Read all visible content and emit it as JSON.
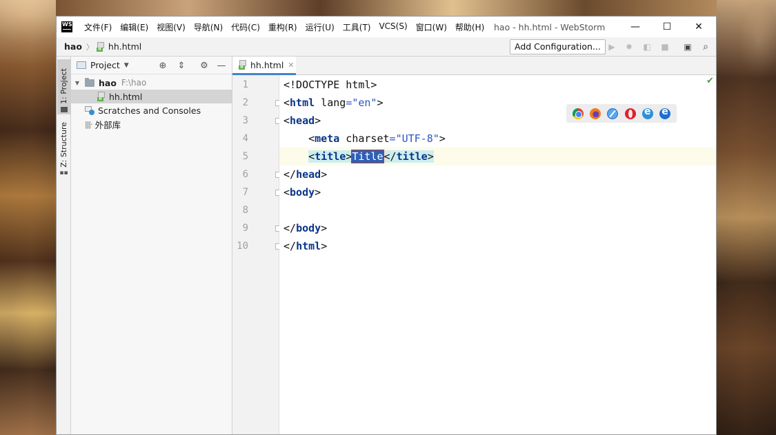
{
  "window": {
    "app_logo": "WS",
    "title": "hao - hh.html - WebStorm",
    "menu": [
      "文件(F)",
      "编辑(E)",
      "视图(V)",
      "导航(N)",
      "代码(C)",
      "重构(R)",
      "运行(U)",
      "工具(T)",
      "VCS(S)",
      "窗口(W)",
      "帮助(H)"
    ],
    "controls": {
      "minimize": "—",
      "maximize": "☐",
      "close": "✕"
    }
  },
  "navbar": {
    "breadcrumb_root": "hao",
    "breadcrumb_file": "hh.html",
    "add_configuration": "Add Configuration...",
    "toolbar_icons": [
      "run-icon",
      "debug-icon",
      "coverage-icon",
      "stop-icon",
      "terminal-icon",
      "search-icon"
    ]
  },
  "tool_tabs": {
    "project": "1: Project",
    "structure": "Z: Structure"
  },
  "project_panel": {
    "title": "Project",
    "tree": [
      {
        "label": "hao",
        "sub": "F:\\hao",
        "type": "folder",
        "expanded": true
      },
      {
        "label": "hh.html",
        "type": "html-file",
        "selected": true
      },
      {
        "label": "Scratches and Consoles",
        "type": "scratches"
      },
      {
        "label": "外部库",
        "type": "library"
      }
    ]
  },
  "editor": {
    "tab_label": "hh.html",
    "line_numbers": [
      "1",
      "2",
      "3",
      "4",
      "5",
      "6",
      "7",
      "8",
      "9",
      "10"
    ],
    "current_line": 5,
    "lines": [
      "<!DOCTYPE html>",
      "<html lang=\"en\">",
      "<head>",
      "    <meta charset=\"UTF-8\">",
      "    <title>Title</title>",
      "</head>",
      "<body>",
      "",
      "</body>",
      "</html>"
    ],
    "tokens": {
      "l1": "<!DOCTYPE html>",
      "l2_open": "<",
      "l2_tag": "html",
      "l2_attr": " lang",
      "l2_eq": "=",
      "l2_val": "\"en\"",
      "l2_close": ">",
      "l3_open": "<",
      "l3_tag": "head",
      "l3_close": ">",
      "l4_indent": "    ",
      "l4_open": "<",
      "l4_tag": "meta",
      "l4_attr": " charset",
      "l4_eq": "=",
      "l4_val": "\"UTF-8\"",
      "l4_close": ">",
      "l5_indent": "    ",
      "l5_open": "<",
      "l5_tag": "title",
      "l5_close": ">",
      "l5_text": "Title",
      "l5_end_open": "</",
      "l5_end_tag": "title",
      "l5_end_close": ">",
      "l6_open": "</",
      "l6_tag": "head",
      "l6_close": ">",
      "l7_open": "<",
      "l7_tag": "body",
      "l7_close": ">",
      "l9_open": "</",
      "l9_tag": "body",
      "l9_close": ">",
      "l10_open": "</",
      "l10_tag": "html",
      "l10_close": ">"
    },
    "browser_icons": [
      "chrome-icon",
      "firefox-icon",
      "safari-icon",
      "opera-icon",
      "ie-icon",
      "edge-icon"
    ],
    "inspection_status": "✔"
  },
  "colors": {
    "tag": "#0a3489",
    "string": "#2a54c7",
    "selection": "#2f5fb5",
    "tab_underline": "#4083c9",
    "current_line": "#fdfbe9"
  }
}
